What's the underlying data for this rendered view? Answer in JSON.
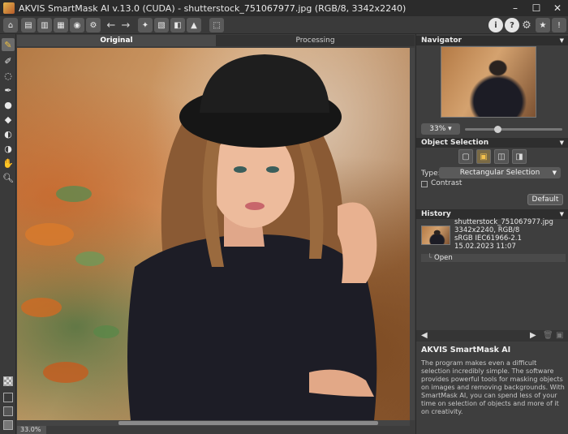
{
  "window": {
    "title": "AKVIS SmartMask AI v.13.0 (CUDA) - shutterstock_751067977.jpg (RGB/8, 3342x2240)",
    "controls": {
      "minimize": "–",
      "maximize": "☐",
      "close": "✕"
    }
  },
  "toolbar": {
    "icons": [
      "home-icon",
      "open-icon",
      "save-icon",
      "print-icon",
      "share-icon",
      "settings-batch-icon",
      "undo-icon",
      "redo-icon",
      "run-icon",
      "bookmark-icon",
      "before-after-icon",
      "background-icon",
      "image-icon",
      "info-icon",
      "help-icon",
      "gear-icon",
      "notification-icon",
      "message-icon"
    ],
    "undo_glyph": "←",
    "redo_glyph": "→"
  },
  "tabs": {
    "original": "Original",
    "processing": "Processing"
  },
  "canvas": {
    "zoom_label": "33.0%"
  },
  "navigator": {
    "title": "Navigator",
    "zoom": "33%"
  },
  "object_selection": {
    "title": "Object Selection",
    "type_label": "Type:",
    "type_value": "Rectangular Selection",
    "contrast_label": "Contrast",
    "default_button": "Default"
  },
  "history": {
    "title": "History",
    "item": {
      "filename": "shutterstock_751067977.jpg",
      "size": "3342x2240, RGB/8",
      "profile": "sRGB IEC61966-2.1",
      "date": "15.02.2023 11:07"
    },
    "open_label": "Open"
  },
  "info": {
    "title": "AKVIS SmartMask AI",
    "text": "The program makes even a difficult selection incredibly simple. The software provides powerful tools for masking objects on images and removing backgrounds. With SmartMask AI, you can spend less of your time on selection of objects and more of it on creativity."
  }
}
